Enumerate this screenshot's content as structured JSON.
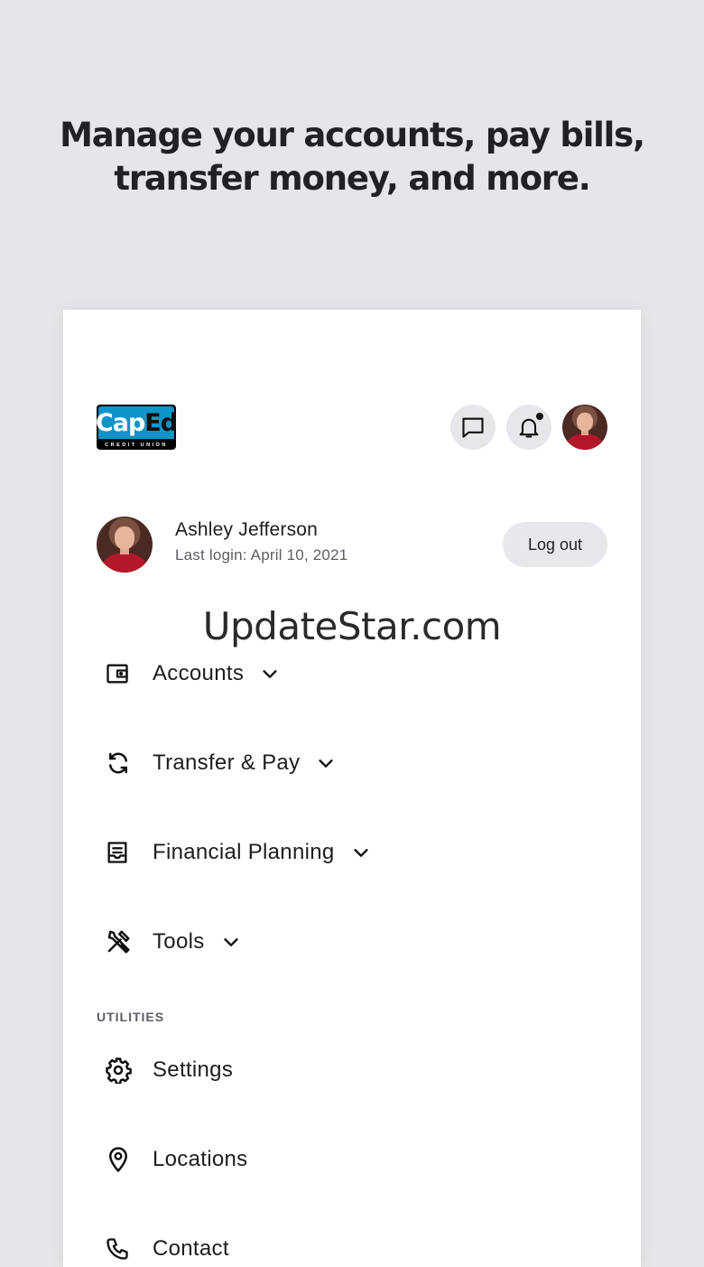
{
  "headline": {
    "line1": "Manage your accounts, pay bills,",
    "line2": "transfer money, and more."
  },
  "brand": {
    "logo_cap": "Cap",
    "logo_ed": "Ed",
    "logo_sub": "CREDIT UNION",
    "primary_color": "#0d94c8"
  },
  "header": {
    "icons": [
      "message-icon",
      "bell-icon",
      "avatar"
    ]
  },
  "profile": {
    "name": "Ashley Jefferson",
    "last_login": "Last login: April 10, 2021",
    "logout_label": "Log out"
  },
  "watermark": "UpdateStar.com",
  "nav": {
    "items": [
      {
        "label": "Accounts",
        "icon": "wallet-icon",
        "expandable": true
      },
      {
        "label": "Transfer & Pay",
        "icon": "transfer-icon",
        "expandable": true
      },
      {
        "label": "Financial Planning",
        "icon": "planning-icon",
        "expandable": true
      },
      {
        "label": "Tools",
        "icon": "tools-icon",
        "expandable": true
      }
    ]
  },
  "utilities": {
    "section_label": "UTILITIES",
    "items": [
      {
        "label": "Settings",
        "icon": "gear-icon"
      },
      {
        "label": "Locations",
        "icon": "location-pin-icon"
      },
      {
        "label": "Contact",
        "icon": "phone-icon"
      }
    ]
  }
}
